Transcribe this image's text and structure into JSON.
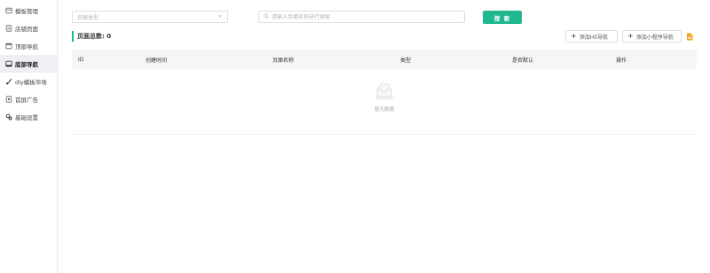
{
  "sidebar": {
    "items": [
      {
        "label": "模板管理",
        "icon": "template-icon",
        "active": false
      },
      {
        "label": "店铺页面",
        "icon": "store-page-icon",
        "active": false
      },
      {
        "label": "顶部导航",
        "icon": "top-nav-icon",
        "active": false
      },
      {
        "label": "底部导航",
        "icon": "bottom-nav-icon",
        "active": true
      },
      {
        "label": "diy模板市场",
        "icon": "brush-icon",
        "active": false
      },
      {
        "label": "首屏广告",
        "icon": "ad-icon",
        "active": false
      },
      {
        "label": "基础设置",
        "icon": "gear-icon",
        "active": false
      }
    ]
  },
  "filters": {
    "type_placeholder": "页面类型",
    "search_placeholder": "请输入页面名称进行搜索",
    "search_button": "搜 索"
  },
  "summary": {
    "count_label": "页面总数: 0"
  },
  "actions": {
    "add_h5": "添加H5导航",
    "add_mini": "添加小程序导航"
  },
  "table": {
    "columns": [
      "ID",
      "创建时间",
      "页面名称",
      "类型",
      "是否默认",
      "操作"
    ],
    "empty_text": "暂无数据"
  },
  "colors": {
    "accent": "#21b88f",
    "export": "#f0a020"
  }
}
